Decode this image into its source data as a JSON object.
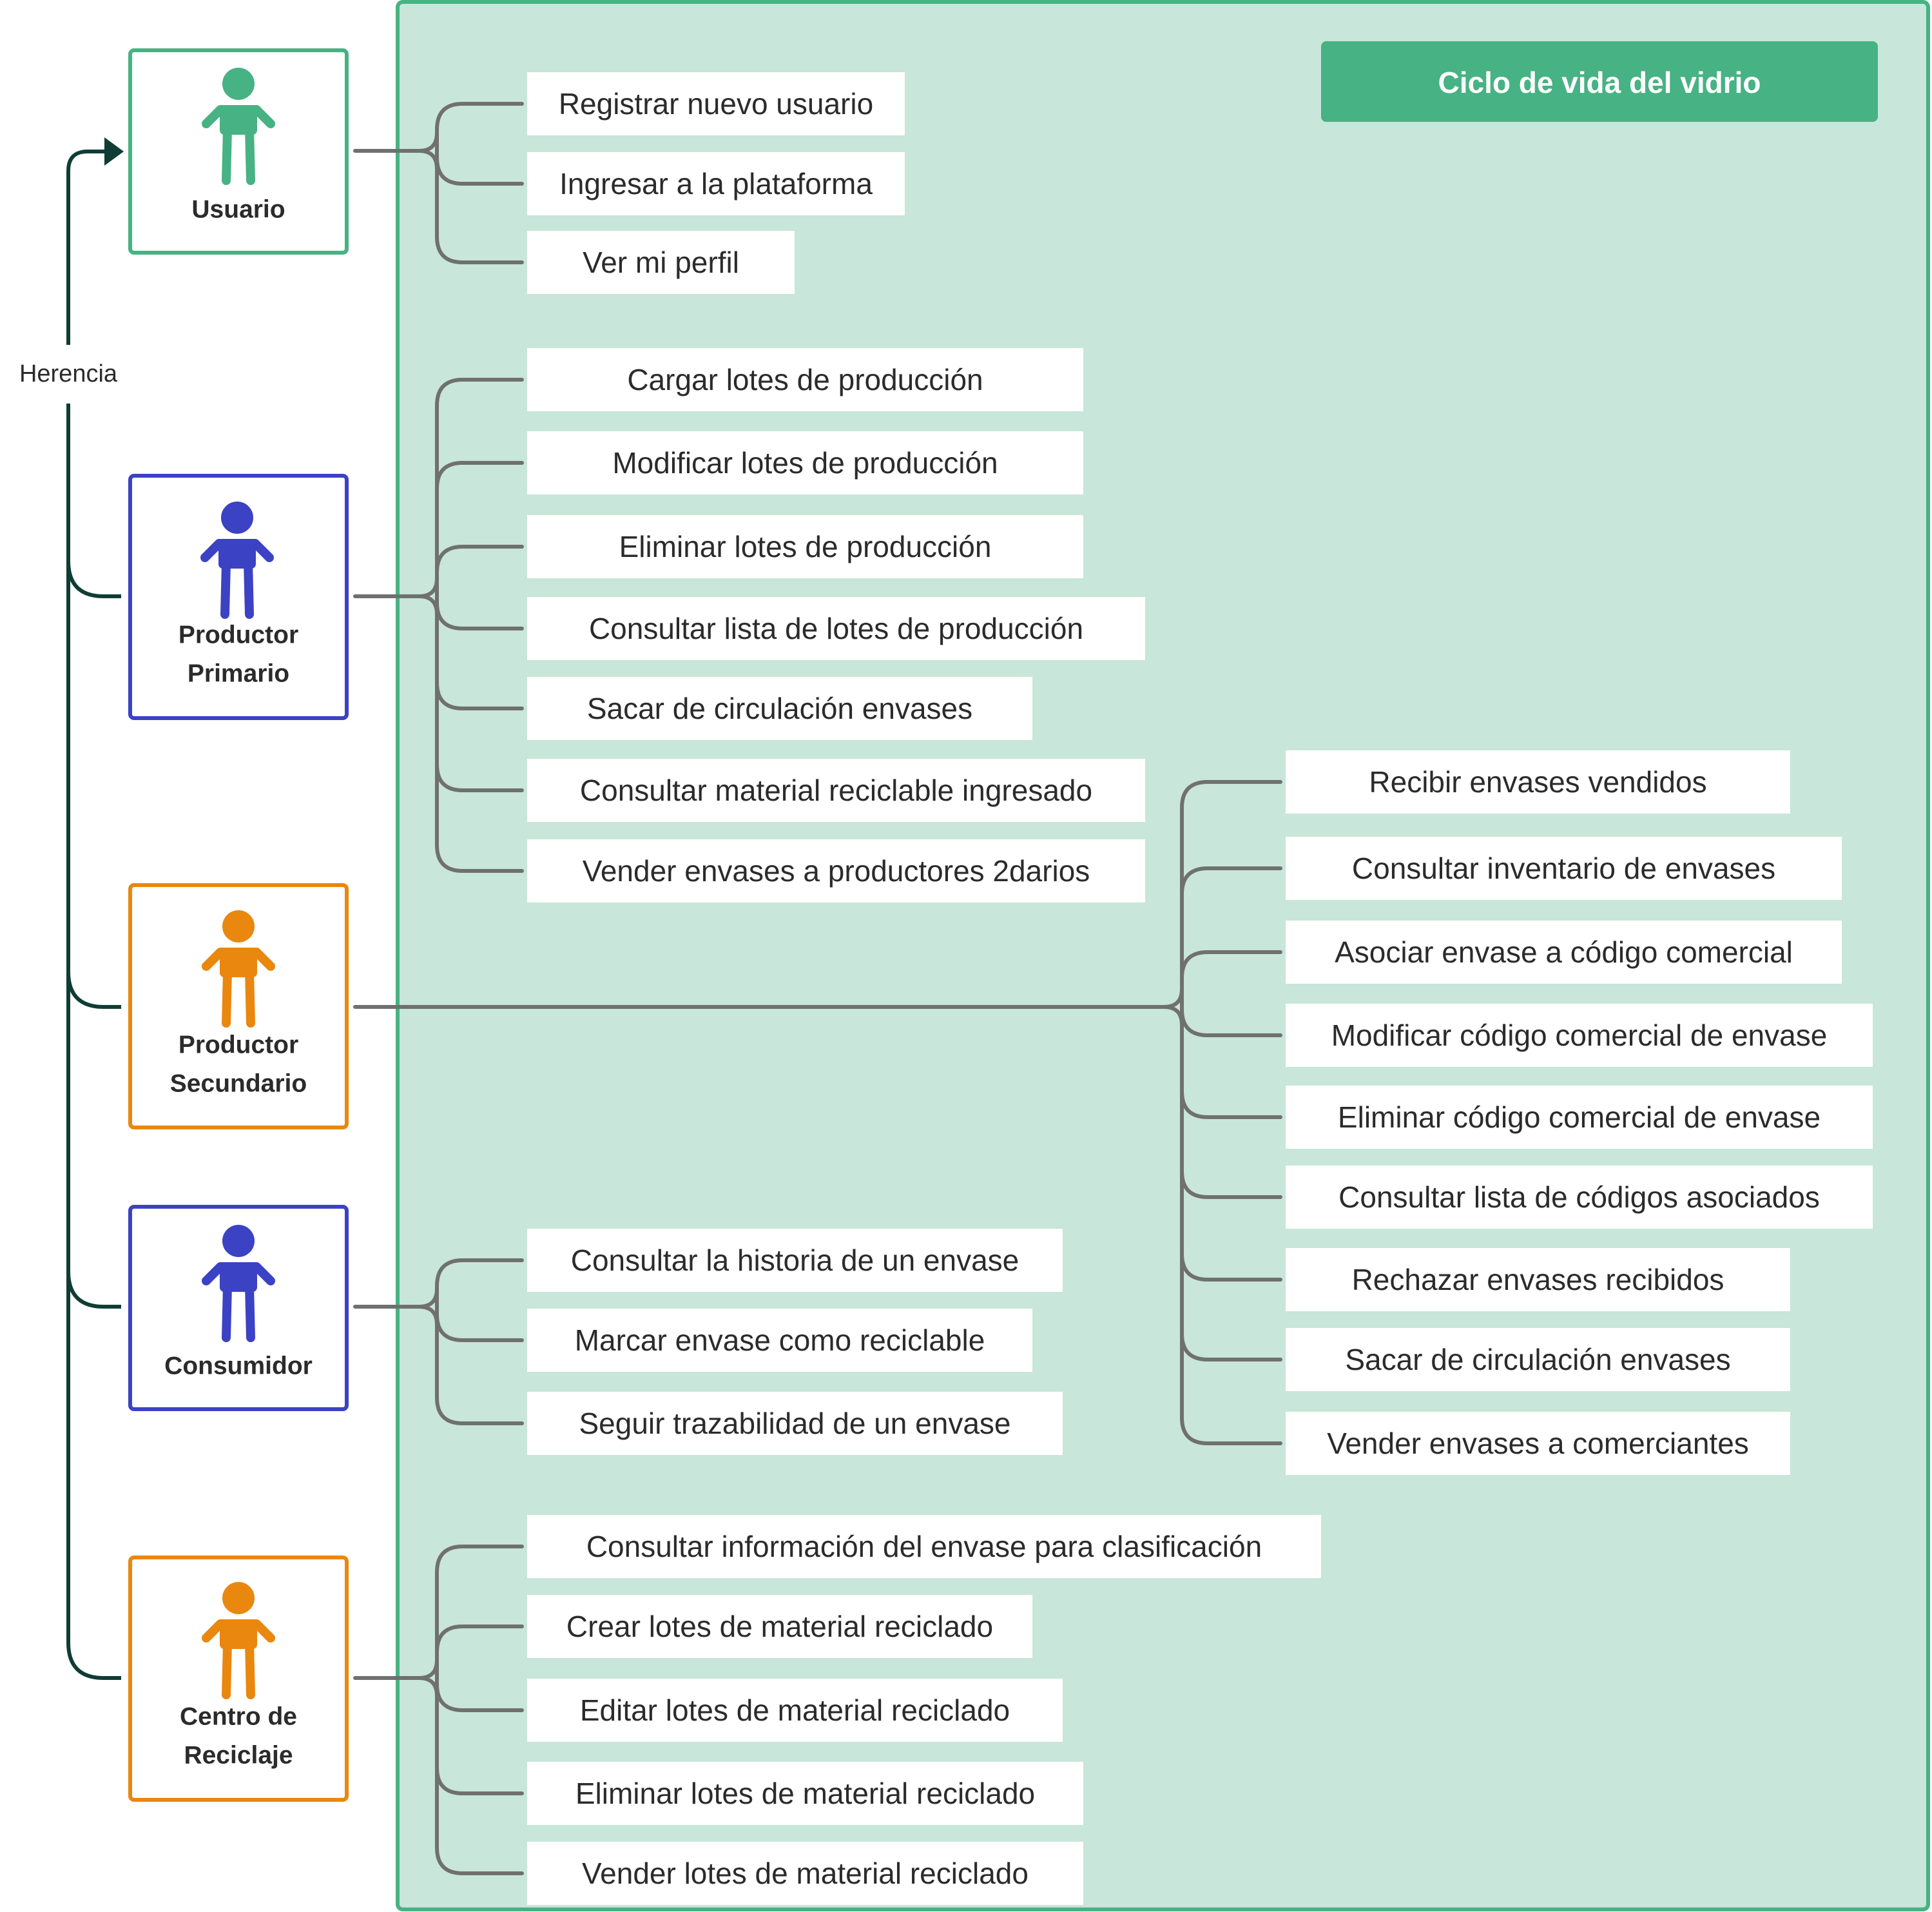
{
  "title": "Ciclo de vida del vidrio",
  "inheritance_label": "Herencia",
  "colors": {
    "system_fill": "#c8e6da",
    "system_border": "#47b283",
    "title_fill": "#47b283",
    "connector": "#707070",
    "inheritance": "#0f3d35",
    "usuario": "#47b283",
    "primario": "#3b42c4",
    "secundario": "#e9870f",
    "consumidor": "#3b42c4",
    "reciclaje": "#e9870f"
  },
  "actors": [
    {
      "id": "usuario",
      "icon": "person-icon",
      "lines": [
        "Usuario"
      ],
      "use_cases": [
        "Registrar nuevo usuario",
        "Ingresar a la plataforma",
        "Ver mi perfil"
      ]
    },
    {
      "id": "primario",
      "icon": "person-icon",
      "lines": [
        "Productor",
        "Primario"
      ],
      "use_cases": [
        "Cargar lotes de producción",
        "Modificar lotes de producción",
        "Eliminar lotes de producción",
        "Consultar lista de lotes de producción",
        "Sacar de circulación envases",
        "Consultar material reciclable ingresado",
        "Vender envases a productores 2darios"
      ]
    },
    {
      "id": "secundario",
      "icon": "person-icon",
      "lines": [
        "Productor",
        "Secundario"
      ],
      "use_cases": [
        "Recibir envases vendidos",
        "Consultar inventario de envases",
        "Asociar envase a código comercial",
        "Modificar código comercial de envase",
        "Eliminar código comercial de envase",
        "Consultar lista de códigos asociados",
        "Rechazar envases recibidos",
        "Sacar de circulación envases",
        "Vender envases a comerciantes"
      ]
    },
    {
      "id": "consumidor",
      "icon": "person-icon",
      "lines": [
        "Consumidor"
      ],
      "use_cases": [
        "Consultar la historia de un envase",
        "Marcar envase como reciclable",
        "Seguir trazabilidad de un envase"
      ]
    },
    {
      "id": "reciclaje",
      "icon": "person-icon",
      "lines": [
        "Centro de",
        "Reciclaje"
      ],
      "use_cases": [
        "Consultar información del envase para clasificación",
        "Crear lotes de material reciclado",
        "Editar lotes de material reciclado",
        "Eliminar lotes de material reciclado",
        "Vender lotes de material reciclado"
      ]
    }
  ]
}
